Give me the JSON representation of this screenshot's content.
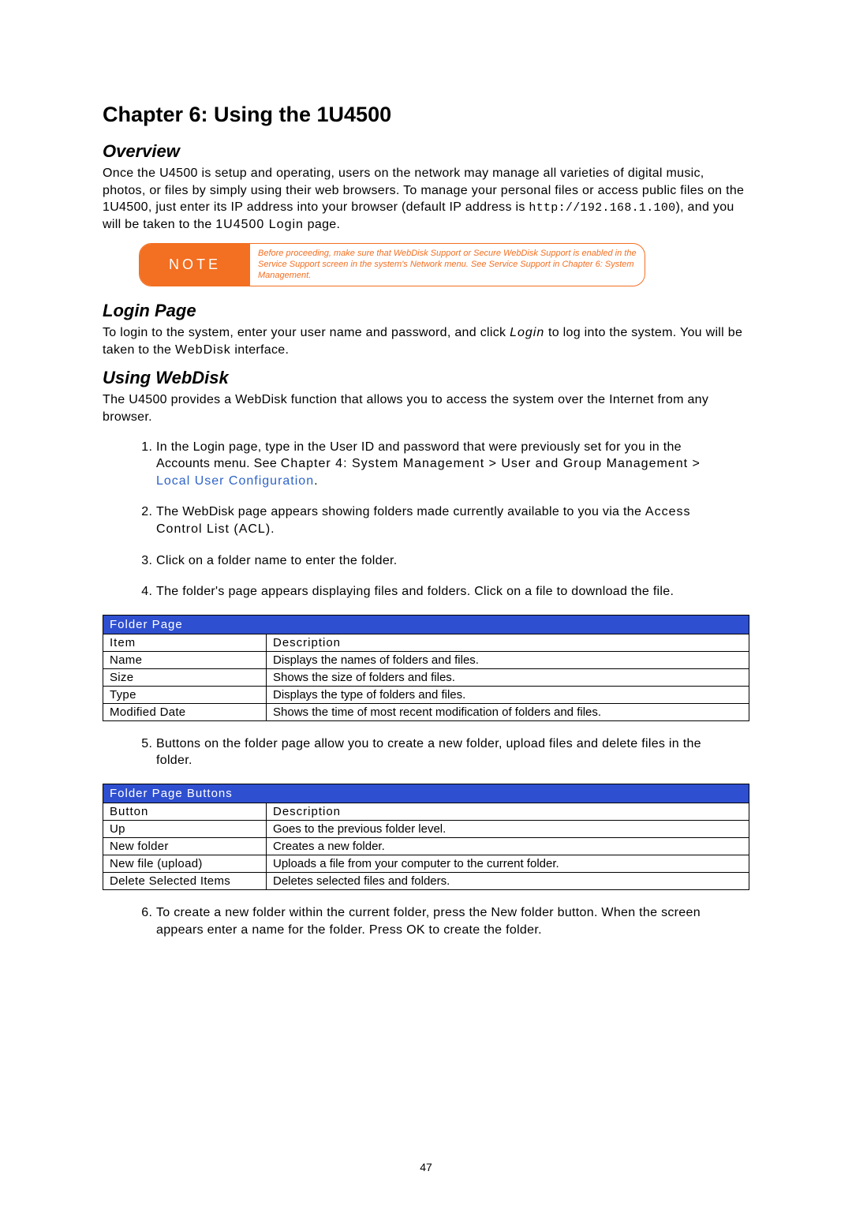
{
  "chapter_title": "Chapter 6: Using the 1U4500",
  "overview": {
    "heading": "Overview",
    "para_pre": "Once the U4500 is setup and operating, users on the network may manage all varieties of digital music, photos, or files by simply using their web browsers. To manage your personal files or access public files on the 1U4500, just enter its IP address into your browser (default IP address is ",
    "ip": "http://192.168.1.100",
    "para_post": "), and you will be taken to the ",
    "login_phrase": "1U4500 Login",
    "para_tail": " page."
  },
  "note": {
    "label": "NOTE",
    "text": "Before proceeding, make sure that WebDisk Support or Secure WebDisk Support is enabled in the Service Support screen in the system's Network menu. See Service Support in Chapter 6: System Management."
  },
  "login": {
    "heading": "Login Page",
    "para_pre": "To login to the system, enter your user name and password, and click ",
    "login_word": "Login",
    "para_mid": " to log into the system. You will be taken to the ",
    "webdisk_word": "WebDisk",
    "para_post": " interface."
  },
  "webdisk": {
    "heading": "Using WebDisk",
    "intro": "The U4500 provides a WebDisk function that allows you to access the system over the Internet from any browser.",
    "step1_pre": "In the Login page, type in the User ID and password that were previously set for you in the Accounts menu. See ",
    "step1_bold": "Chapter 4: System Management > User and Group Management > ",
    "step1_link": "Local User Configuration",
    "step1_post": ".",
    "step2_pre": "The WebDisk page appears showing folders made currently available to you via the ",
    "step2_acl": "Access Control List (ACL)",
    "step2_post": ".",
    "step3": "Click on a folder name to enter the folder.",
    "step4": "The folder's page appears displaying files and folders. Click on a file to download the file.",
    "step5": "Buttons on the folder page allow you to create a new folder, upload files and delete files in the folder.",
    "step6": "To create a new folder within the current folder, press the New folder button. When the screen appears enter a name for the folder. Press OK to create the folder."
  },
  "table1": {
    "title": "Folder Page",
    "col1": "Item",
    "col2": "Description",
    "rows": [
      {
        "a": "Name",
        "b": "Displays the names of folders and files."
      },
      {
        "a": "Size",
        "b": "Shows the size of folders and files."
      },
      {
        "a": "Type",
        "b": "Displays the type of folders and files."
      },
      {
        "a": "Modified Date",
        "b": "Shows the time of most recent modification of folders and files."
      }
    ]
  },
  "table2": {
    "title": "Folder Page Buttons",
    "col1": "Button",
    "col2": "Description",
    "rows": [
      {
        "a": "Up",
        "b": "Goes to the previous folder level."
      },
      {
        "a": "New folder",
        "b": "Creates a new folder."
      },
      {
        "a": "New file (upload)",
        "b": "Uploads a file from your computer to the current folder."
      },
      {
        "a": "Delete Selected Items",
        "b": "Deletes selected files and folders."
      }
    ]
  },
  "page_number": "47"
}
